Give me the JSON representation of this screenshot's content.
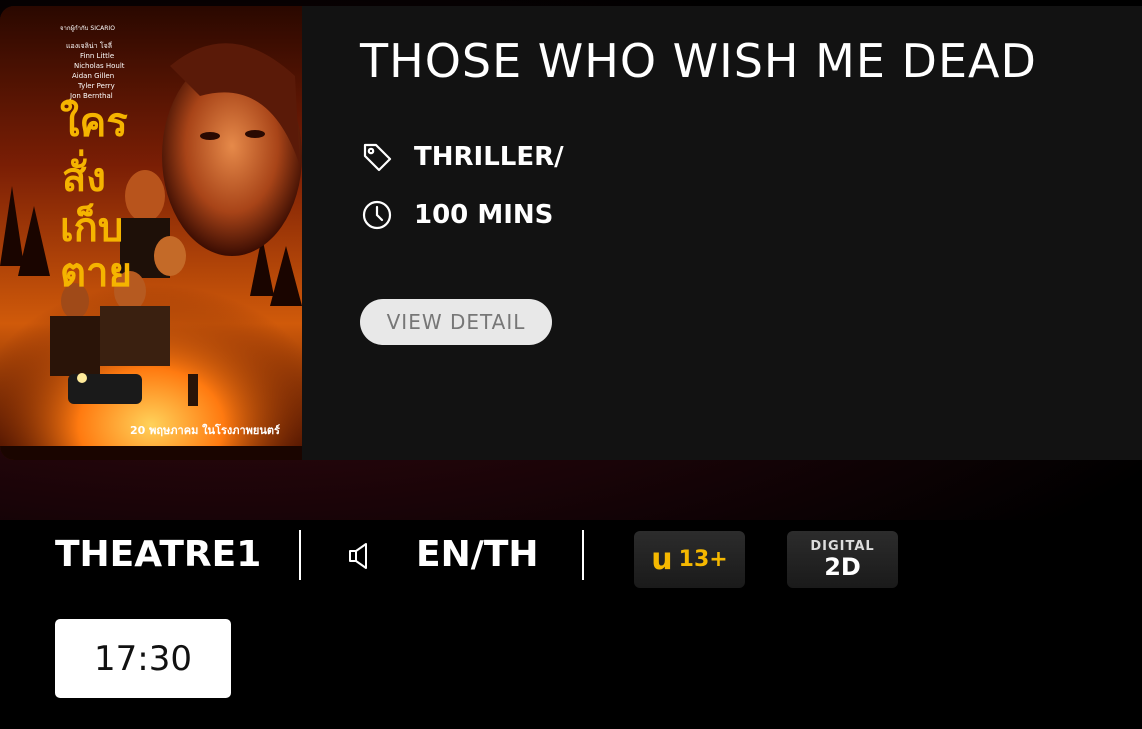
{
  "movie": {
    "title": "THOSE WHO WISH ME DEAD",
    "genre": "THRILLER/",
    "duration": "100 MINS",
    "view_detail_label": "VIEW DETAIL",
    "poster": {
      "title_th": "ใครสั่งเก็บตาย",
      "release_th": "20 พฤษภาคม ในโรงภาพยนตร์",
      "credits_top": "จากผู้กำกับ SICARIO",
      "cast_lines": [
        "แองเจลิน่า โจลี่",
        "Finn Little",
        "Nicholas Hoult",
        "Aidan Gillen",
        "Tyler Perry",
        "Jon Bernthal"
      ]
    }
  },
  "showtime": {
    "theatre": "THEATRE1",
    "language": "EN/TH",
    "rating": {
      "prefix": "u",
      "age": "13+"
    },
    "format": {
      "top": "DIGITAL",
      "bottom": "2D"
    },
    "times": [
      "17:30"
    ]
  },
  "icons": {
    "genre": "tag-icon",
    "duration": "clock-icon",
    "audio": "speaker-icon"
  },
  "colors": {
    "card_bg": "#121212",
    "rating_yellow": "#f5b800",
    "button_bg": "#e8e8e8",
    "time_bg": "#ffffff"
  }
}
